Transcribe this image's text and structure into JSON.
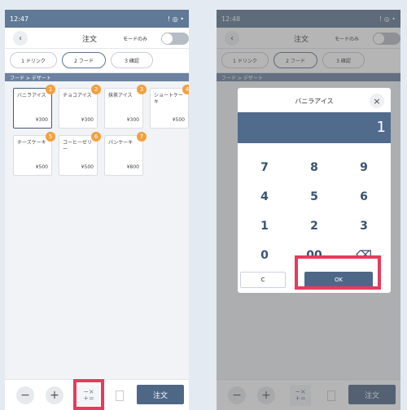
{
  "left": {
    "status_time": "12:47",
    "status_icons": "! ◎ •",
    "title": "注文",
    "mode_label": "モードのみ",
    "steps": [
      "1 ドリンク",
      "2 フード",
      "3 確認"
    ],
    "breadcrumb": "フード > デザート",
    "items": [
      {
        "name": "バニラアイス",
        "price": "¥300",
        "badge": "1"
      },
      {
        "name": "チョコアイス",
        "price": "¥300",
        "badge": "2"
      },
      {
        "name": "抹茶アイス",
        "price": "¥300",
        "badge": "3"
      },
      {
        "name": "ショートケーキ",
        "price": "¥500",
        "badge": "4"
      },
      {
        "name": "チーズケーキ",
        "price": "¥500",
        "badge": "5"
      },
      {
        "name": "コーヒーゼリー",
        "price": "¥500",
        "badge": "6"
      },
      {
        "name": "パンケーキ",
        "price": "¥800",
        "badge": "7"
      }
    ],
    "bottom": {
      "minus": "−",
      "plus": "+",
      "calc": "−×\n+=",
      "order": "注文"
    }
  },
  "right": {
    "status_time": "12:48",
    "status_icons": "! ◎ •",
    "title": "注文",
    "mode_label": "モードのみ",
    "steps": [
      "1 ドリンク",
      "2 フード",
      "3 確認"
    ],
    "breadcrumb": "フード > デザート",
    "dialog": {
      "title": "バニラアイス",
      "close": "×",
      "value": "1",
      "keys": [
        "7",
        "8",
        "9",
        "4",
        "5",
        "6",
        "1",
        "2",
        "3",
        "0",
        "00",
        "⌫"
      ],
      "clear": "C",
      "ok": "OK"
    },
    "bottom": {
      "minus": "−",
      "plus": "+",
      "calc": "−×\n+=",
      "order": "注文"
    }
  }
}
